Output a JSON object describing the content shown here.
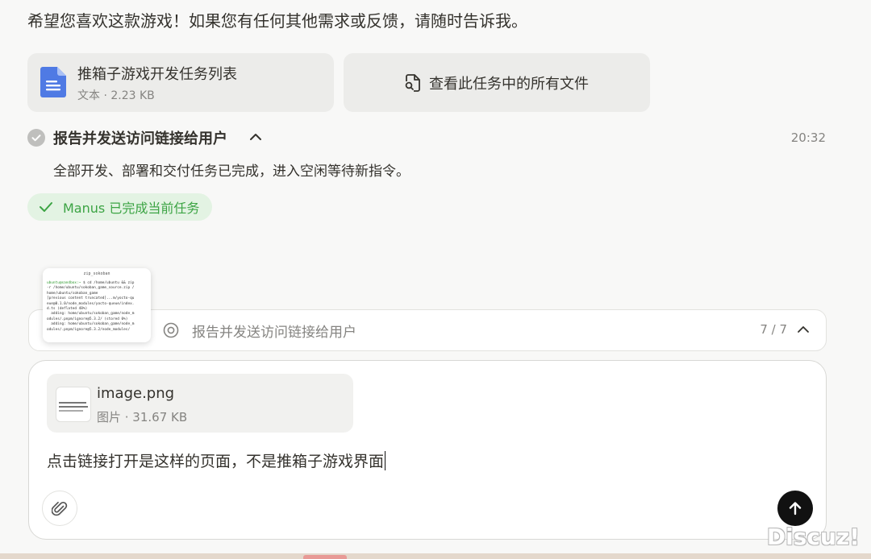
{
  "message": {
    "text": "希望您喜欢这款游戏！如果您有任何其他需求或反馈，请随时告诉我。"
  },
  "file_card": {
    "name": "推箱子游戏开发任务列表",
    "meta": "文本 · 2.23 KB",
    "icon": "document-icon"
  },
  "all_files_button": {
    "label": "查看此任务中的所有文件",
    "icon": "file-search-icon"
  },
  "step": {
    "title": "报告并发送访问链接给用户",
    "time": "20:32",
    "description": "全部开发、部署和交付任务已完成，进入空闲等待新指令。",
    "icon": "check-circle-icon"
  },
  "status_badge": {
    "label": "Manus 已完成当前任务",
    "color": "#3ca444"
  },
  "task_bar": {
    "label": "报告并发送访问链接给用户",
    "progress": "7 / 7"
  },
  "terminal_thumbnail": {
    "title": "zip_sokoban",
    "prompt": "ubuntu@sandbox:~",
    "lines": [
      "$ cd /home/ubuntu && zip",
      "-r /home/ubuntu/sokoban_game_source.zip /",
      "home/ubuntu/sokoban_game",
      "[previous content truncated]...m/yocto-qu",
      "eue@0.1.0/node_modules/yocto-queue/index.",
      "d.ts (deflated 48%)",
      "  adding: home/ubuntu/sokoban_game/node_m",
      "odules/.pnpm/ignore@5.3.2/ (stored 0%)",
      "  adding: home/ubuntu/sokoban_game/node_m",
      "odules/.pnpm/ignore@5.3.2/node_modules/"
    ]
  },
  "composer": {
    "attachment": {
      "name": "image.png",
      "meta": "图片 · 31.67 KB"
    },
    "input_text": "点击链接打开是这样的页面，不是推箱子游戏界面"
  },
  "watermark": "Discuz!"
}
